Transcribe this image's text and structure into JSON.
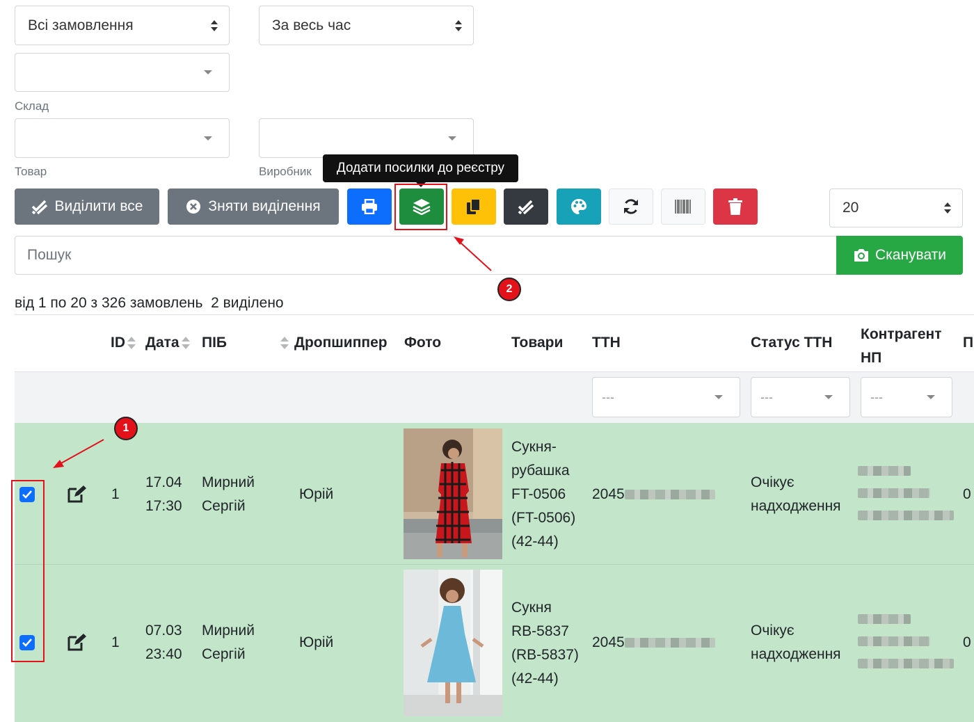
{
  "filters": {
    "orders_select": "Всі замовлення",
    "period_select": "За весь час",
    "warehouse_label": "Склад",
    "product_label": "Товар",
    "manufacturer_label": "Виробник",
    "per_page": "20"
  },
  "toolbar": {
    "select_all": "Виділити все",
    "deselect": "Зняти виділення",
    "tooltip": "Додати посилки до реєстру"
  },
  "search": {
    "placeholder": "Пошук",
    "scan_label": "Сканувати"
  },
  "summary": {
    "range": "від 1 по 20 з 326 замовлень",
    "selected": "2 виділено"
  },
  "table": {
    "headers": {
      "id": "ID",
      "date": "Дата",
      "name": "ПІБ",
      "dropshipper": "Дропшиппер",
      "photo": "Фото",
      "products": "Товари",
      "ttn": "ТТН",
      "ttn_status": "Статус ТТН",
      "contractor_1": "Контрагент",
      "contractor_2": "НП",
      "next": "П"
    },
    "filter_placeholder": "---",
    "rows": [
      {
        "id": "1",
        "date": "17.04",
        "time": "17:30",
        "name_1": "Мирний",
        "name_2": "Сергій",
        "dropshipper": "Юрій",
        "product_lines": [
          "Сукня-",
          "рубашка",
          "FT-0506",
          "(FT-0506)",
          "(42-44)"
        ],
        "ttn_prefix": "2045",
        "status_1": "Очікує",
        "status_2": "надходження",
        "last": "0"
      },
      {
        "id": "1",
        "date": "07.03",
        "time": "23:40",
        "name_1": "Мирний",
        "name_2": "Сергій",
        "dropshipper": "Юрій",
        "product_lines": [
          "Сукня",
          "RB-5837",
          "(RB-5837)",
          "(42-44)"
        ],
        "ttn_prefix": "2045",
        "status_1": "Очікує",
        "status_2": "надходження",
        "last": "0"
      }
    ]
  },
  "annotations": {
    "badge_1": "1",
    "badge_2": "2"
  },
  "colors": {
    "primary": "#0d6efd",
    "success": "#28a745",
    "dark_green": "#1e8e3e",
    "warning": "#ffc107",
    "dark": "#343a40",
    "info": "#17a2b8",
    "danger": "#dc3545",
    "secondary": "#6c757d",
    "row_highlight": "#c3e6cb",
    "annotation_red": "#e3111a"
  }
}
